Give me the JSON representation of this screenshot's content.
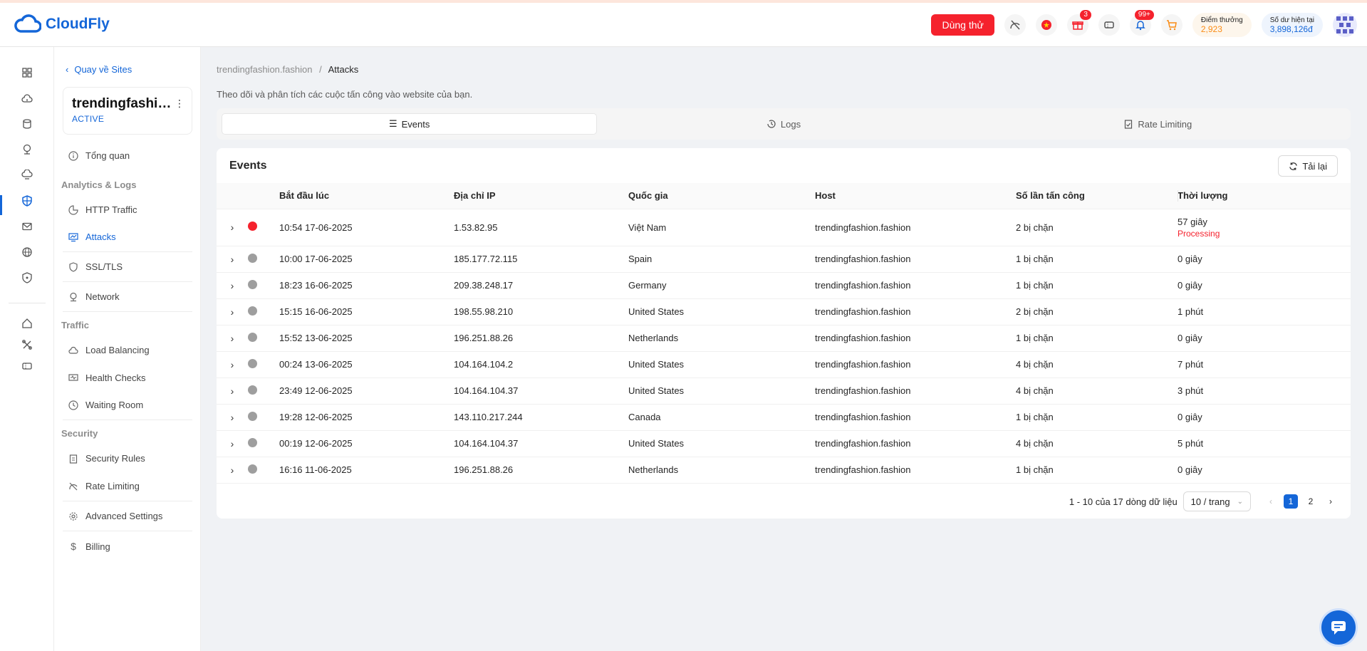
{
  "brand": {
    "name": "CloudFly",
    "color": "#1466d8"
  },
  "header": {
    "trial_label": "Dùng thử",
    "gift_badge": "3",
    "notif_badge": "99+",
    "points_label": "Điểm thưởng",
    "points_value": "2,923",
    "balance_label": "Số dư hiện tại",
    "balance_value": "3,898,126đ"
  },
  "sidebar": {
    "back_label": "Quay về Sites",
    "site_name": "trendingfashion.fashion",
    "site_status": "ACTIVE",
    "overview": "Tổng quan",
    "sec_analytics": "Analytics & Logs",
    "http_traffic": "HTTP Traffic",
    "attacks": "Attacks",
    "ssl": "SSL/TLS",
    "network": "Network",
    "sec_traffic": "Traffic",
    "load_balancing": "Load Balancing",
    "health_checks": "Health Checks",
    "waiting_room": "Waiting Room",
    "sec_security": "Security",
    "security_rules": "Security Rules",
    "rate_limiting": "Rate Limiting",
    "advanced": "Advanced Settings",
    "billing": "Billing"
  },
  "breadcrumb": {
    "site": "trendingfashion.fashion",
    "sep": "/",
    "current": "Attacks"
  },
  "description": "Theo dõi và phân tích các cuộc tấn công vào website của bạn.",
  "tabs": {
    "events": "Events",
    "logs": "Logs",
    "rate_limiting": "Rate Limiting"
  },
  "events": {
    "title": "Events",
    "reload_label": "Tải lại",
    "columns": {
      "start": "Bắt đầu lúc",
      "ip": "Địa chỉ IP",
      "country": "Quốc gia",
      "host": "Host",
      "attacks": "Số lần tấn công",
      "duration": "Thời lượng"
    },
    "rows": [
      {
        "start": "10:54 17-06-2025",
        "ip": "1.53.82.95",
        "country": "Việt Nam",
        "host": "trendingfashion.fashion",
        "attacks": "2 bị chặn",
        "duration": "57 giây",
        "status": "Processing"
      },
      {
        "start": "10:00 17-06-2025",
        "ip": "185.177.72.115",
        "country": "Spain",
        "host": "trendingfashion.fashion",
        "attacks": "1 bị chặn",
        "duration": "0 giây"
      },
      {
        "start": "18:23 16-06-2025",
        "ip": "209.38.248.17",
        "country": "Germany",
        "host": "trendingfashion.fashion",
        "attacks": "1 bị chặn",
        "duration": "0 giây"
      },
      {
        "start": "15:15 16-06-2025",
        "ip": "198.55.98.210",
        "country": "United States",
        "host": "trendingfashion.fashion",
        "attacks": "2 bị chặn",
        "duration": "1 phút"
      },
      {
        "start": "15:52 13-06-2025",
        "ip": "196.251.88.26",
        "country": "Netherlands",
        "host": "trendingfashion.fashion",
        "attacks": "1 bị chặn",
        "duration": "0 giây"
      },
      {
        "start": "00:24 13-06-2025",
        "ip": "104.164.104.2",
        "country": "United States",
        "host": "trendingfashion.fashion",
        "attacks": "4 bị chặn",
        "duration": "7 phút"
      },
      {
        "start": "23:49 12-06-2025",
        "ip": "104.164.104.37",
        "country": "United States",
        "host": "trendingfashion.fashion",
        "attacks": "4 bị chặn",
        "duration": "3 phút"
      },
      {
        "start": "19:28 12-06-2025",
        "ip": "143.110.217.244",
        "country": "Canada",
        "host": "trendingfashion.fashion",
        "attacks": "1 bị chặn",
        "duration": "0 giây"
      },
      {
        "start": "00:19 12-06-2025",
        "ip": "104.164.104.37",
        "country": "United States",
        "host": "trendingfashion.fashion",
        "attacks": "4 bị chặn",
        "duration": "5 phút"
      },
      {
        "start": "16:16 11-06-2025",
        "ip": "196.251.88.26",
        "country": "Netherlands",
        "host": "trendingfashion.fashion",
        "attacks": "1 bị chặn",
        "duration": "0 giây"
      }
    ],
    "pagination": {
      "summary": "1 - 10 của 17 dòng dữ liệu",
      "page_size": "10 / trang",
      "page1": "1",
      "page2": "2"
    }
  }
}
